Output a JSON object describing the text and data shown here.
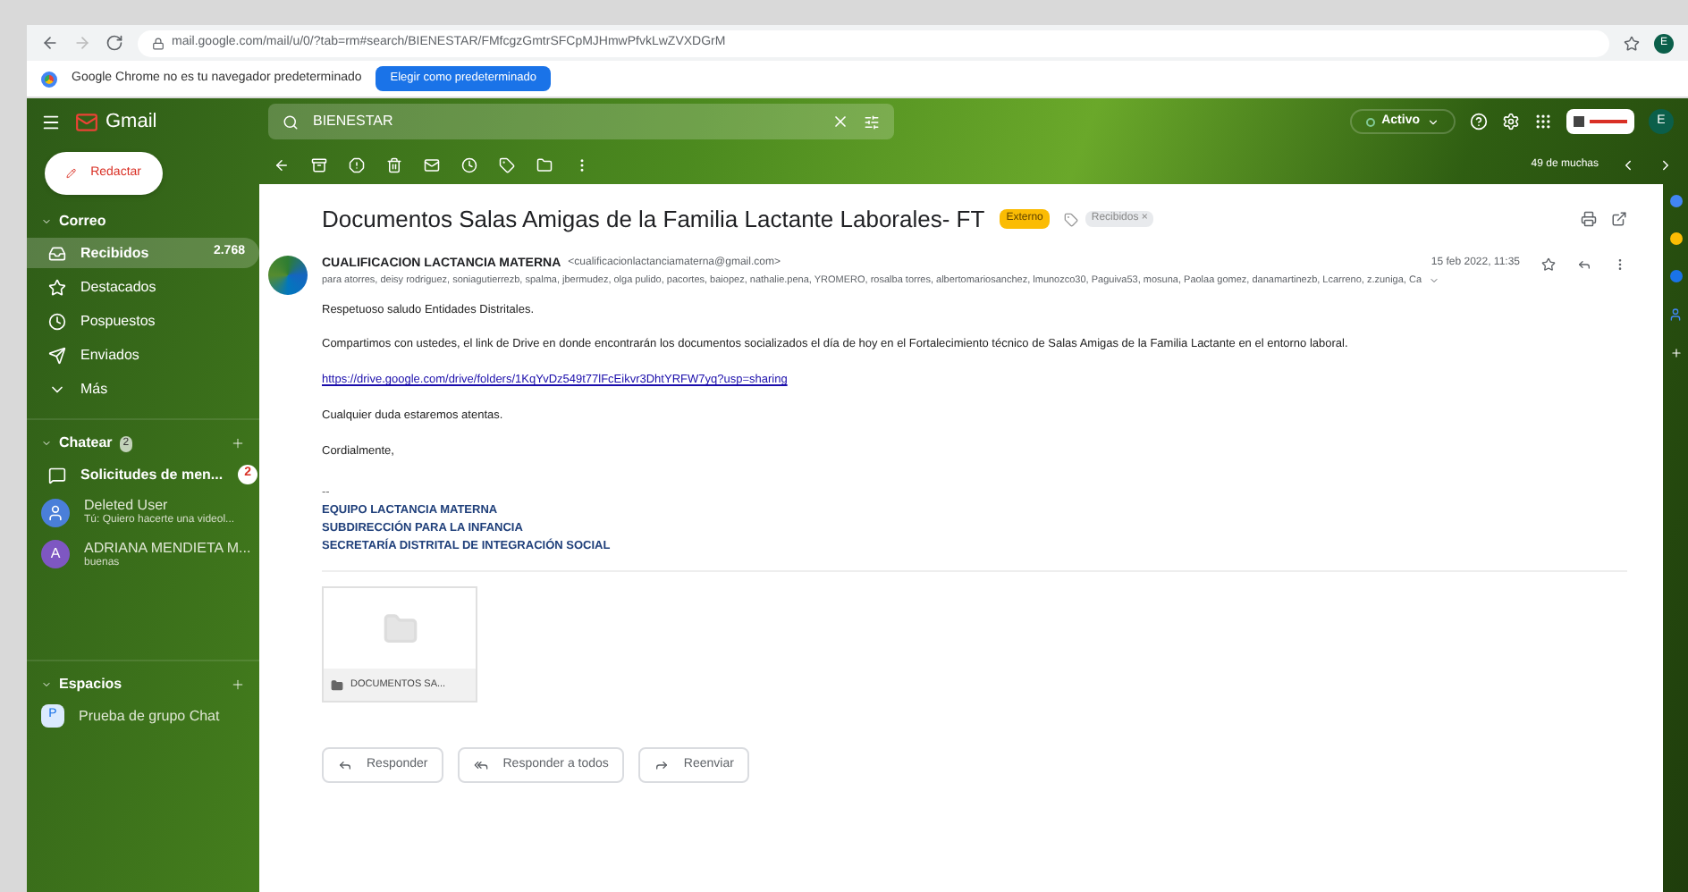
{
  "browser": {
    "url": "mail.google.com/mail/u/0/?tab=rm#search/BIENESTAR/FMfcgzGmtrSFCpMJHmwPfvkLwZVXDGrM",
    "infobar": "Google Chrome no es tu navegador predeterminado",
    "infobar_button": "Elegir como predeterminado",
    "avatar": "E"
  },
  "header": {
    "logo": "Gmail",
    "search": "BIENESTAR",
    "status": "Activo",
    "avatar": "E"
  },
  "sidebar": {
    "compose": "Redactar",
    "sections": [
      {
        "title": "Correo",
        "add": false,
        "items": [
          {
            "kind": "inbox",
            "label": "Recibidos",
            "count": "2.768",
            "selected": true
          },
          {
            "kind": "star",
            "label": "Destacados",
            "selected": false
          },
          {
            "kind": "clock",
            "label": "Pospuestos",
            "selected": false
          },
          {
            "kind": "send",
            "label": "Enviados",
            "selected": false
          },
          {
            "kind": "more",
            "label": "Más",
            "selected": false
          }
        ]
      },
      {
        "title": "Chatear",
        "badge": "2",
        "add": true,
        "items": [
          {
            "kind": "requests",
            "label": "Solicitudes de men...",
            "count": "2",
            "selected": false
          },
          {
            "kind": "person",
            "label": "Deleted User",
            "sub": "Tú: Quiero hacerte una videol...",
            "color": "#4a7fd9",
            "selected": false
          },
          {
            "kind": "person",
            "label": "ADRIANA MENDIETA M...",
            "sub": "buenas",
            "initial": "A",
            "color": "#7e57c2",
            "selected": false
          }
        ]
      },
      {
        "title": "Espacios",
        "add": true,
        "items": [
          {
            "kind": "space",
            "label": "Prueba de grupo Chat",
            "initial": "P",
            "selected": false
          }
        ]
      }
    ]
  },
  "toolbar": {
    "pager": "49 de muchas"
  },
  "email": {
    "subject": "Documentos Salas Amigas de la Familia Lactante Laborales- FT",
    "tags": [
      {
        "kind": "external",
        "label": "Externo"
      },
      {
        "kind": "label",
        "label": "Recibidos",
        "remove": "×"
      }
    ],
    "sender": "CUALIFICACION LACTANCIA MATERNA",
    "sender_email": "<cualificacionlactanciamaterna@gmail.com>",
    "recipients": "para atorres, deisy rodriguez, soniagutierrezb, spalma, jbermudez, olga pulido, pacortes, baiopez, nathalie.pena, YROMERO, rosalba torres, albertomariosanchez, lmunozco30, Paguiva53, mosuna, Paolaa gomez, danamartinezb, Lcarreno, z.zuniga, Ca",
    "date": "15 feb 2022, 11:35",
    "body": [
      "Respetuoso saludo Entidades Distritales.",
      "Compartimos con ustedes, el link de Drive en donde encontrarán los documentos socializados el día de hoy en el Fortalecimiento técnico de Salas Amigas de la Familia Lactante en el entorno laboral."
    ],
    "link": "https://drive.google.com/drive/folders/1KqYvDz549t77lFcEikvr3DhtYRFW7yq?usp=sharing",
    "closing": [
      "Cualquier duda estaremos atentas.",
      "Cordialmente,"
    ],
    "signature_sep": "--",
    "signature": [
      "EQUIPO LACTANCIA MATERNA",
      "SUBDIRECCIÓN PARA LA INFANCIA",
      "SECRETARÍA DISTRITAL DE INTEGRACIÓN SOCIAL"
    ],
    "attachment": "DOCUMENTOS SA...",
    "actions": [
      {
        "kind": "reply",
        "label": "Responder"
      },
      {
        "kind": "replyall",
        "label": "Responder a todos"
      },
      {
        "kind": "forward",
        "label": "Reenviar"
      }
    ]
  }
}
